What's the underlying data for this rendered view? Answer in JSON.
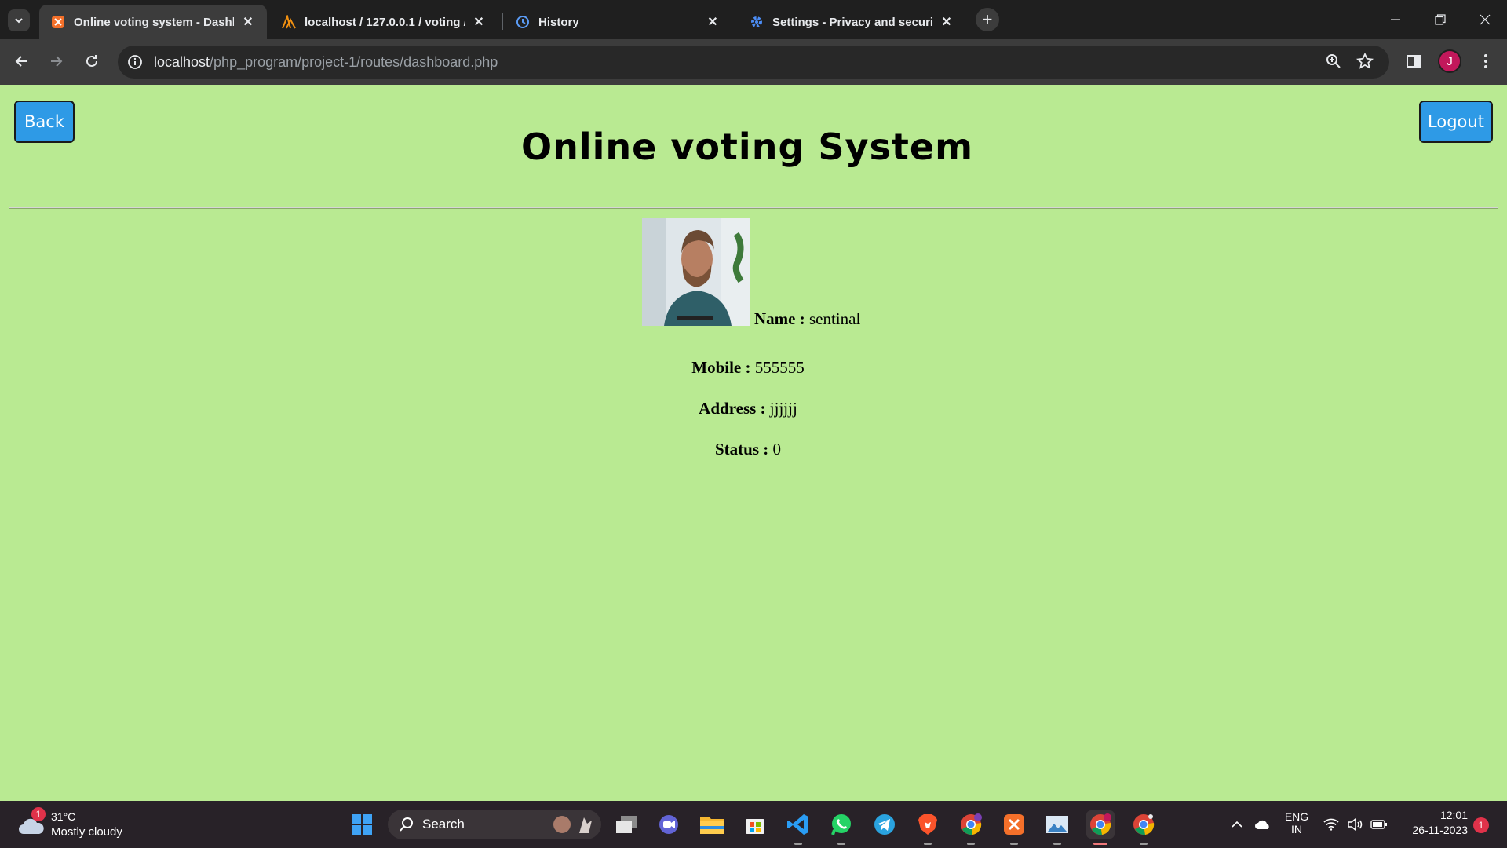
{
  "browser": {
    "tabs": [
      {
        "title": "Online voting system - Dashbo",
        "active": true
      },
      {
        "title": "localhost / 127.0.0.1 / voting / u",
        "active": false
      },
      {
        "title": "History",
        "active": false
      },
      {
        "title": "Settings - Privacy and security",
        "active": false
      }
    ],
    "url_host": "localhost",
    "url_path": "/php_program/project-1/routes/dashboard.php",
    "profile_initial": "J"
  },
  "page": {
    "back_label": "Back",
    "logout_label": "Logout",
    "title": "Online voting System",
    "profile": {
      "name_label": "Name :",
      "name_value": "sentinal",
      "mobile_label": "Mobile :",
      "mobile_value": "555555",
      "address_label": "Address :",
      "address_value": "jjjjjj",
      "status_label": "Status :",
      "status_value": "0"
    },
    "colors": {
      "background": "#b9ea92",
      "button": "#2e9ae6"
    }
  },
  "taskbar": {
    "weather_temp": "31°C",
    "weather_condition": "Mostly cloudy",
    "weather_badge": "1",
    "search_placeholder": "Search",
    "lang_line1": "ENG",
    "lang_line2": "IN",
    "time": "12:01",
    "date": "26-11-2023",
    "notification_count": "1"
  }
}
